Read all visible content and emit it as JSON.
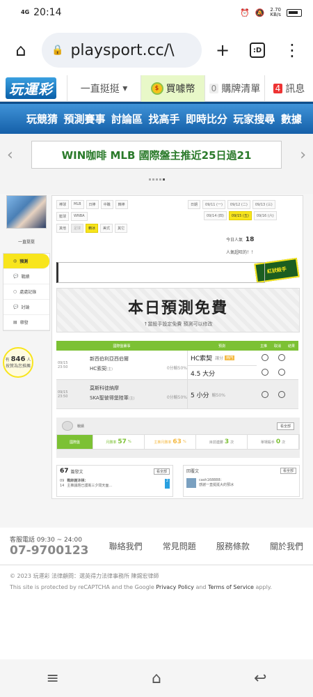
{
  "status": {
    "network": "4G",
    "time": "20:14",
    "speed": "2.70",
    "speed_unit": "KB/s"
  },
  "browser": {
    "url": "playsport.cc/\\",
    "tabs_label": ":D",
    "home_icon": "home-icon",
    "add_icon": "plus-icon",
    "menu_icon": "more-vert-icon"
  },
  "site_header": {
    "logo_text": "玩運彩",
    "cheer": "一直挺挺",
    "cheer_arrow": "▾",
    "buy_coin": "買噱幣",
    "buy_list_count": "0",
    "buy_list": "購牌清單",
    "msg_count": "4",
    "messages": "訊息"
  },
  "nav": [
    "玩競猜",
    "預測賽事",
    "討論區",
    "找高手",
    "即時比分",
    "玩家搜尋",
    "數據"
  ],
  "banner": {
    "text": "WIN咖啡 MLB 國際盤主推近25日過21",
    "prev": "‹",
    "next": "›"
  },
  "sidebar": {
    "user_name": "一直挺挺",
    "menu": [
      {
        "label": "預測",
        "icon": "target-icon"
      },
      {
        "label": "戰績",
        "icon": "chat-icon"
      },
      {
        "label": "處處記錄",
        "icon": "circle-icon"
      },
      {
        "label": "討論",
        "icon": "chat-icon"
      },
      {
        "label": "帶發",
        "icon": "doc-icon"
      }
    ],
    "rec_prefix": "有",
    "rec_count": "846",
    "rec_suffix": "人",
    "rec_line2": "按贊為您推薦"
  },
  "filters": {
    "rows": [
      {
        "label": "棒球",
        "items": [
          "MLB",
          "日棒",
          "中職",
          "韓棒"
        ]
      },
      {
        "label": "籃球",
        "items": [
          "WNBA"
        ]
      },
      {
        "label": "其他",
        "items": [
          "足球",
          "賴冰",
          "美式",
          "其它"
        ]
      }
    ]
  },
  "dates": {
    "label": "日期",
    "row1": [
      "09/11 (一)",
      "09/12 (二)",
      "09/13 (三)"
    ],
    "row2": [
      "09/14 (四)",
      "09/15 (五)",
      "09/16 (六)"
    ],
    "selected": "09/15 (五)"
  },
  "today": {
    "label": "今日人氣",
    "count": "18",
    "adv": "人氣超旺的！！"
  },
  "badge_text": "紅狀殺手",
  "free": {
    "title": "本日預測免費",
    "sub": "↑當殺手設定免費 預測可以修改"
  },
  "pred_table": {
    "headers": [
      "國際盤賽事",
      "預測",
      "主推",
      "取消",
      "結果"
    ],
    "rows": [
      {
        "time": "09/15 23:50",
        "team1": "新西伯利亞西伯爾",
        "team2": "HC索契",
        "team2_tag": "(主)",
        "odds": "0分輸50%",
        "pick1": "HC索契",
        "pick1_note": "讓分",
        "hot": "熱門",
        "pick2": "4.5 大分"
      },
      {
        "time": "09/15 23:50",
        "team1": "莫斯科徒納摩",
        "team2": "SKA聖彼得堡陸軍",
        "team2_tag": "(主)",
        "odds": "0分輸50%",
        "pick1": "5 小分",
        "pick1_note": "輸50%",
        "hot": "",
        "pick2": ""
      }
    ]
  },
  "record": {
    "label": "戰績",
    "more": "看全部",
    "tab": "國際盤",
    "month_rate_label": "月勝率",
    "month_rate": "57",
    "season_rate_label": "主推月勝率",
    "season_rate": "63",
    "streak_label": "目前連勝",
    "streak": "3",
    "single_label": "單場殺手",
    "single": "0",
    "pct": "%",
    "times": "次"
  },
  "posts": {
    "count": "67",
    "label": "篇發文",
    "more": "看全部",
    "item_date": "09",
    "item_day": "14",
    "item_title": "戰帥謝沐祺：",
    "item_text": "主推議題已護衛三夕問天面...",
    "item_num": "2"
  },
  "replies": {
    "label": "回覆文",
    "more": "看全部",
    "item_user": "cash168888：",
    "item_text": "感謝一直挺挺大的預冰"
  },
  "footer": {
    "service_label": "客服電話 09:30 ~ 24:00",
    "phone": "07-9700123",
    "links": [
      "聯絡我們",
      "常見問題",
      "服務條款",
      "關於我們"
    ]
  },
  "copyright": {
    "line1": "© 2023 玩運彩 法律顧問：選英得力法律事務所 陳錫宏律師",
    "line2a": "This site is protected by reCAPTCHA and the Google ",
    "privacy": "Privacy Policy",
    "and": " and ",
    "terms": "Terms of Service",
    "apply": " apply."
  },
  "android_nav": {
    "menu": "≡",
    "home": "⌂",
    "back": "↩"
  }
}
